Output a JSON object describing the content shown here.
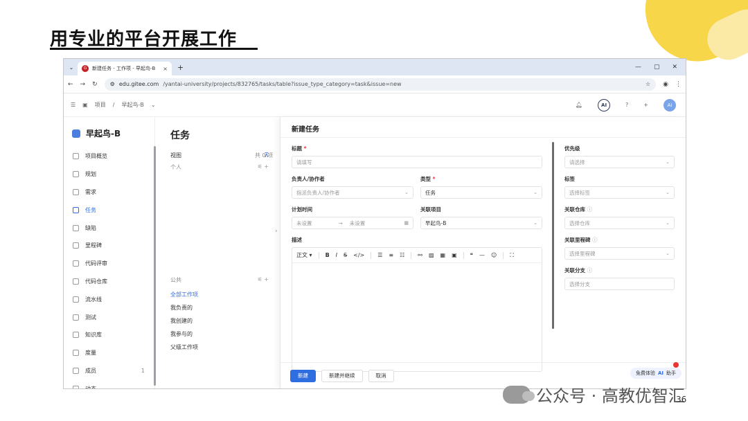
{
  "slide": {
    "title": "用专业的平台开展工作",
    "page_number": "36",
    "watermark": "公众号 · 高教优智汇"
  },
  "browser": {
    "tab_title": "新建任务 - 工作项 - 早起鸟-B",
    "url_host": "edu.gitee.com",
    "url_path": "/yantai-university/projects/832765/tasks/table?issue_type_category=task&issue=new"
  },
  "app_header": {
    "crumb_project": "项目",
    "crumb_current": "早起鸟-B",
    "ai_label": "AI",
    "avatar_label": "Ai"
  },
  "sidebar": {
    "project_name": "早起鸟-B",
    "items": [
      {
        "label": "项目概览"
      },
      {
        "label": "规划"
      },
      {
        "label": "需求"
      },
      {
        "label": "任务"
      },
      {
        "label": "缺陷"
      },
      {
        "label": "里程碑"
      },
      {
        "label": "代码评审"
      },
      {
        "label": "代码仓库"
      },
      {
        "label": "流水线"
      },
      {
        "label": "测试"
      },
      {
        "label": "知识库"
      },
      {
        "label": "度量"
      },
      {
        "label": "成员",
        "count": "1"
      },
      {
        "label": "动态"
      }
    ]
  },
  "tasks_panel": {
    "title": "任务",
    "views_label": "视图",
    "total": "共 0 项",
    "group_personal": "个人",
    "group_public": "公共",
    "public_views": [
      "全部工作项",
      "我负责的",
      "我创建的",
      "我参与的",
      "父级工作项"
    ]
  },
  "modal": {
    "title": "新建任务",
    "title_label": "标题",
    "title_placeholder": "请填写",
    "assignee_label": "负责人/协作者",
    "assignee_placeholder": "指派负责人/协作者",
    "type_label": "类型",
    "type_value": "任务",
    "plan_label": "计划时间",
    "plan_start": "未设置",
    "plan_end": "未设置",
    "related_project_label": "关联项目",
    "related_project_value": "早起鸟-B",
    "desc_label": "描述",
    "editor_format": "正文",
    "priority_label": "优先级",
    "priority_placeholder": "请选择",
    "tag_label": "标签",
    "tag_placeholder": "选择标签",
    "repo_label": "关联仓库",
    "repo_placeholder": "选择仓库",
    "milestone_label": "关联里程碑",
    "milestone_placeholder": "选择里程碑",
    "branch_label": "关联分支",
    "branch_placeholder": "选择分支",
    "btn_create": "新建",
    "btn_create_continue": "新建并继续",
    "btn_cancel": "取消",
    "ai_pill_prefix": "免费体验",
    "ai_pill_ai": "AI",
    "ai_pill_suffix": "助手"
  }
}
